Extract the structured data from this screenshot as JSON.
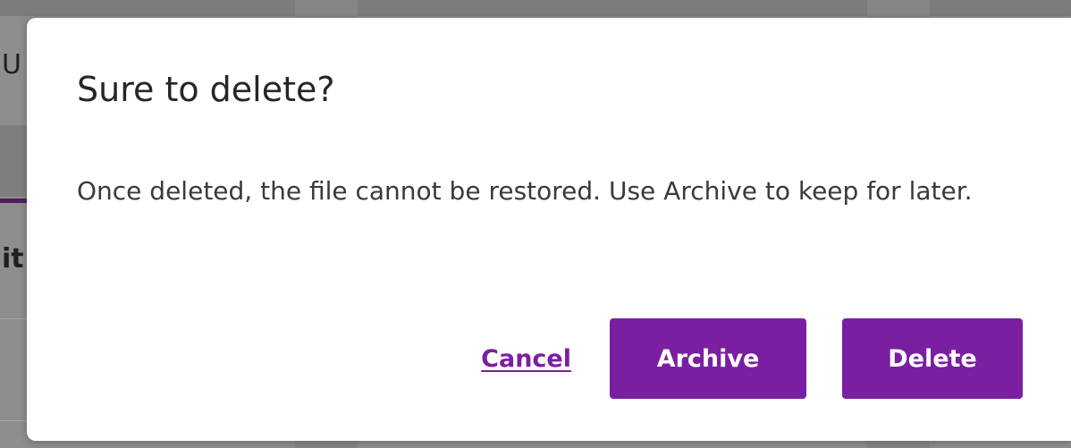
{
  "background": {
    "peek_text_top": "U",
    "peek_text_middle": "it"
  },
  "dialog": {
    "title": "Sure to delete?",
    "message": "Once deleted, the file cannot be restored. Use Archive to keep for later.",
    "actions": {
      "cancel_label": "Cancel",
      "archive_label": "Archive",
      "delete_label": "Delete"
    }
  },
  "colors": {
    "accent": "#7b1fa2",
    "overlay": "#8e8e8e",
    "dialog_background": "#ffffff",
    "title_text": "#262626"
  }
}
